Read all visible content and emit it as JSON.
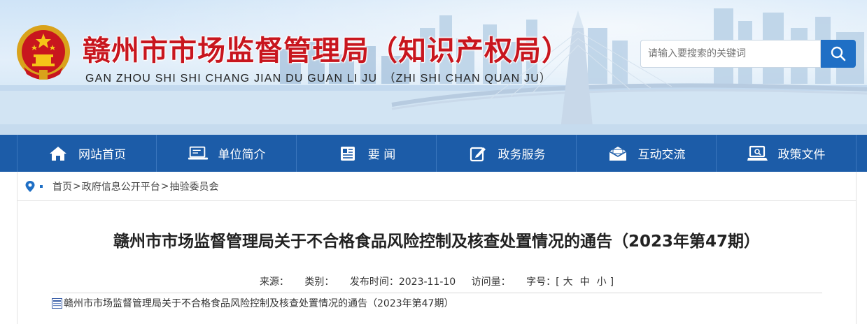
{
  "header": {
    "site_title": "赣州市市场监督管理局（知识产权局）",
    "site_pinyin": "GAN ZHOU SHI SHI CHANG JIAN DU GUAN LI JU　（ZHI SHI CHAN QUAN JU）",
    "search": {
      "placeholder": "请输入要搜索的关键词"
    },
    "emblem_icon": "national-emblem",
    "search_icon": "search-icon"
  },
  "nav": {
    "items": [
      {
        "label": "网站首页",
        "icon": "home-icon"
      },
      {
        "label": "单位简介",
        "icon": "monitor-icon"
      },
      {
        "label": "要 闻",
        "icon": "newspaper-icon"
      },
      {
        "label": "政务服务",
        "icon": "edit-icon"
      },
      {
        "label": "互动交流",
        "icon": "mail-icon"
      },
      {
        "label": "政策文件",
        "icon": "laptop-icon"
      }
    ]
  },
  "breadcrumb": {
    "items": [
      "首页",
      "政府信息公开平台",
      "抽验委员会"
    ],
    "separator": ">"
  },
  "article": {
    "title": "赣州市市场监督管理局关于不合格食品风险控制及核查处置情况的通告（2023年第47期）",
    "meta": {
      "source_label": "来源：",
      "category_label": "类别：",
      "publish_label": "发布时间：2023-11-10",
      "visits_label": "访问量：",
      "size_label": "字号：",
      "size_open": "[",
      "size_large": "大",
      "size_medium": "中",
      "size_small": "小",
      "size_close": "]"
    },
    "attachment": "赣州市市场监督管理局关于不合格食品风险控制及核查处置情况的通告（2023年第47期）"
  },
  "colors": {
    "nav_bg": "#1c5ca8",
    "title_red": "#c8161e",
    "search_btn": "#1f6fc5"
  }
}
